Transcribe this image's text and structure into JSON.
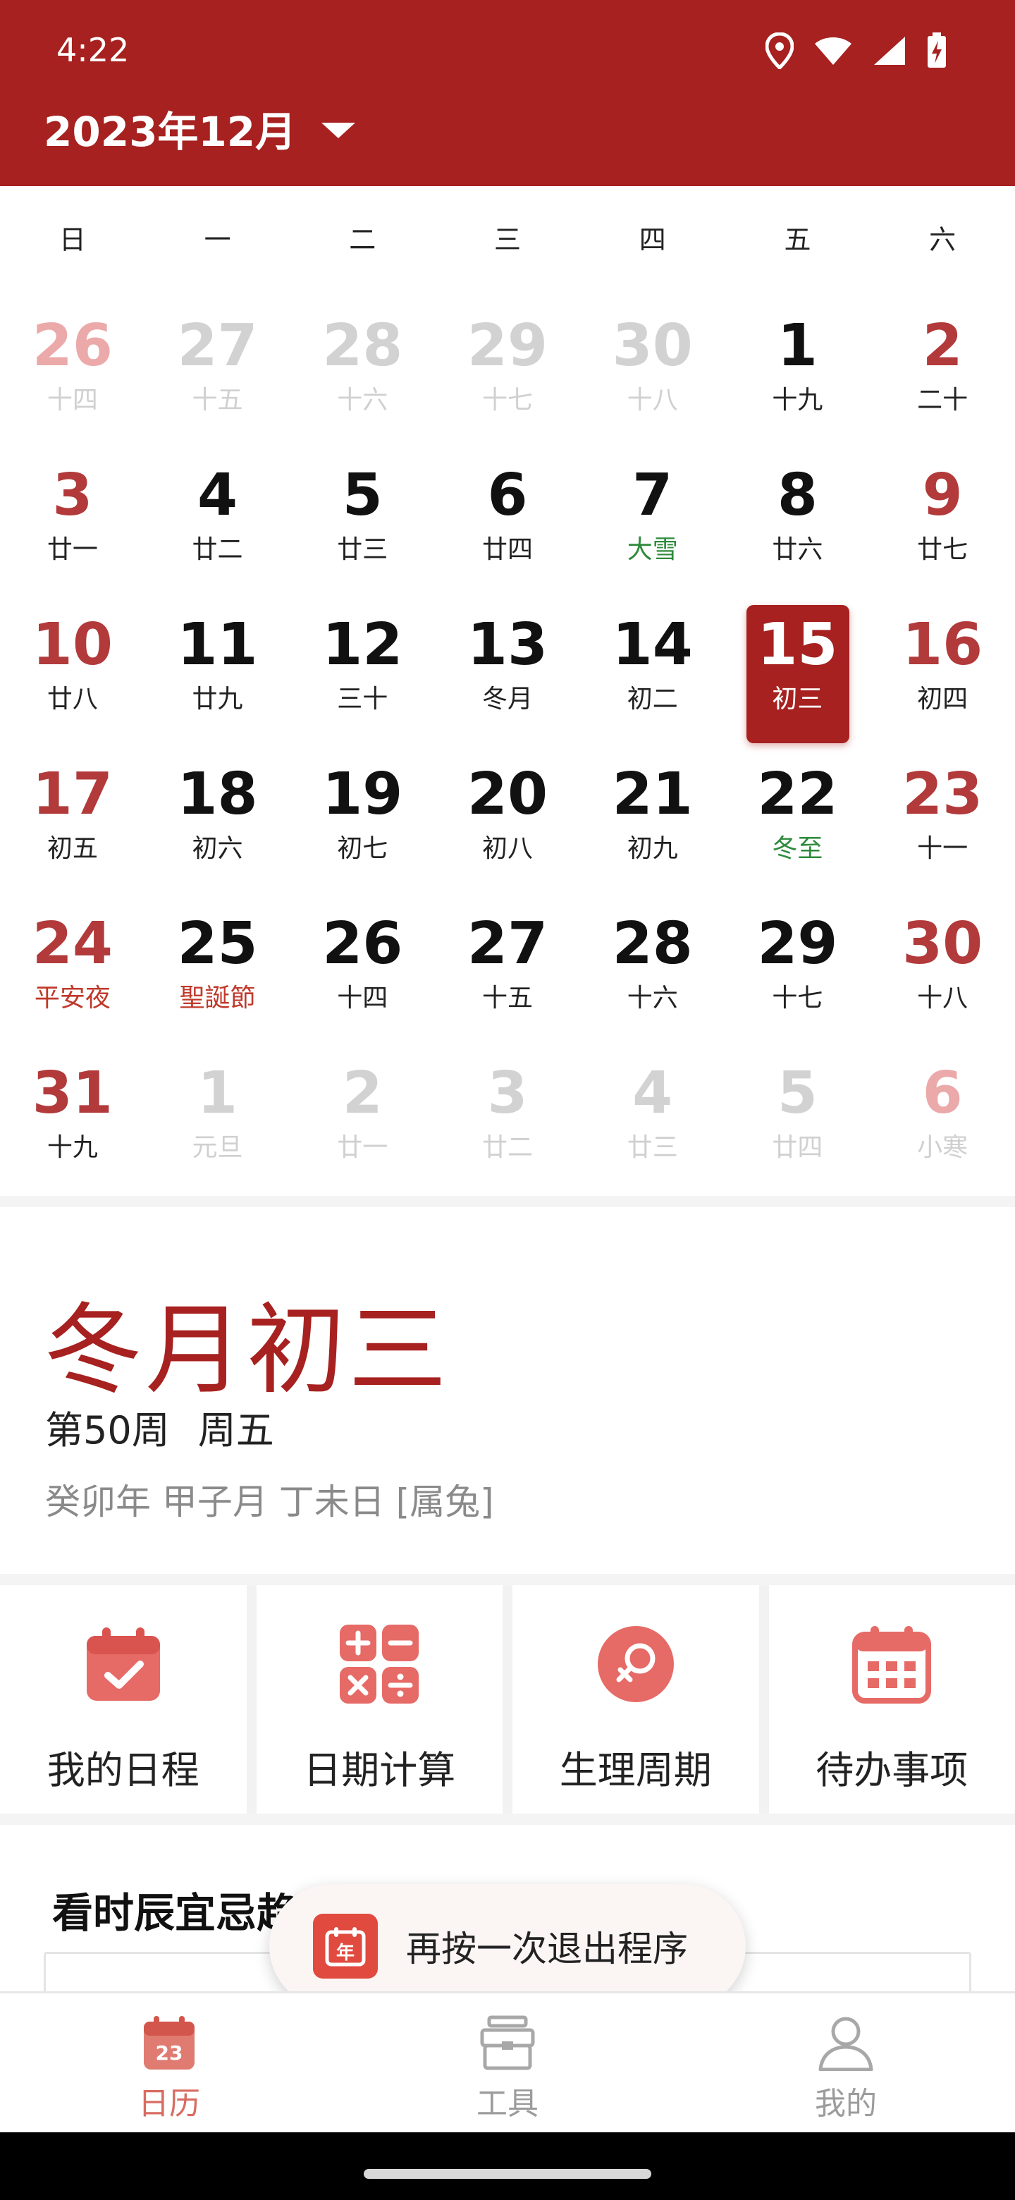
{
  "status": {
    "time": "4:22"
  },
  "header": {
    "month_title": "2023年12月"
  },
  "weekdays": [
    "日",
    "一",
    "二",
    "三",
    "四",
    "五",
    "六"
  ],
  "calendar": {
    "rows": [
      [
        {
          "n": "26",
          "l": "十四"
        },
        {
          "n": "27",
          "l": "十五"
        },
        {
          "n": "28",
          "l": "十六"
        },
        {
          "n": "29",
          "l": "十七"
        },
        {
          "n": "30",
          "l": "十八"
        },
        {
          "n": "1",
          "l": "十九"
        },
        {
          "n": "2",
          "l": "二十"
        }
      ],
      [
        {
          "n": "3",
          "l": "廿一"
        },
        {
          "n": "4",
          "l": "廿二"
        },
        {
          "n": "5",
          "l": "廿三"
        },
        {
          "n": "6",
          "l": "廿四"
        },
        {
          "n": "7",
          "l": "大雪"
        },
        {
          "n": "8",
          "l": "廿六"
        },
        {
          "n": "9",
          "l": "廿七"
        }
      ],
      [
        {
          "n": "10",
          "l": "廿八"
        },
        {
          "n": "11",
          "l": "廿九"
        },
        {
          "n": "12",
          "l": "三十"
        },
        {
          "n": "13",
          "l": "冬月"
        },
        {
          "n": "14",
          "l": "初二"
        },
        {
          "n": "15",
          "l": "初三"
        },
        {
          "n": "16",
          "l": "初四"
        }
      ],
      [
        {
          "n": "17",
          "l": "初五"
        },
        {
          "n": "18",
          "l": "初六"
        },
        {
          "n": "19",
          "l": "初七"
        },
        {
          "n": "20",
          "l": "初八"
        },
        {
          "n": "21",
          "l": "初九"
        },
        {
          "n": "22",
          "l": "冬至"
        },
        {
          "n": "23",
          "l": "十一"
        }
      ],
      [
        {
          "n": "24",
          "l": "平安夜"
        },
        {
          "n": "25",
          "l": "聖誕節"
        },
        {
          "n": "26",
          "l": "十四"
        },
        {
          "n": "27",
          "l": "十五"
        },
        {
          "n": "28",
          "l": "十六"
        },
        {
          "n": "29",
          "l": "十七"
        },
        {
          "n": "30",
          "l": "十八"
        }
      ],
      [
        {
          "n": "31",
          "l": "十九"
        },
        {
          "n": "1",
          "l": "元旦"
        },
        {
          "n": "2",
          "l": "廿一"
        },
        {
          "n": "3",
          "l": "廿二"
        },
        {
          "n": "4",
          "l": "廿三"
        },
        {
          "n": "5",
          "l": "廿四"
        },
        {
          "n": "6",
          "l": "小寒"
        }
      ]
    ]
  },
  "selected_day": {
    "lunar_date": "冬月初三",
    "week_number": "第50周",
    "weekday": "周五",
    "ganzhi": "癸卯年 甲子月 丁未日 [属兔]"
  },
  "tools": [
    {
      "label": "我的日程",
      "icon": "calendar-check-icon"
    },
    {
      "label": "日期计算",
      "icon": "calculator-icon"
    },
    {
      "label": "生理周期",
      "icon": "female-symbol-icon"
    },
    {
      "label": "待办事项",
      "icon": "calendar-grid-icon"
    }
  ],
  "almanac": {
    "title": "看时辰宜忌趋吉避凶"
  },
  "toast": {
    "text": "再按一次退出程序",
    "icon_text": "年"
  },
  "bottom_nav": [
    {
      "label": "日历",
      "icon_text": "23"
    },
    {
      "label": "工具"
    },
    {
      "label": "我的"
    }
  ],
  "colors": {
    "brand_red": "#a6211f",
    "weekend_red": "#b23a3a",
    "solar_term_green": "#2e8b3b",
    "holiday_red": "#c0392b"
  }
}
